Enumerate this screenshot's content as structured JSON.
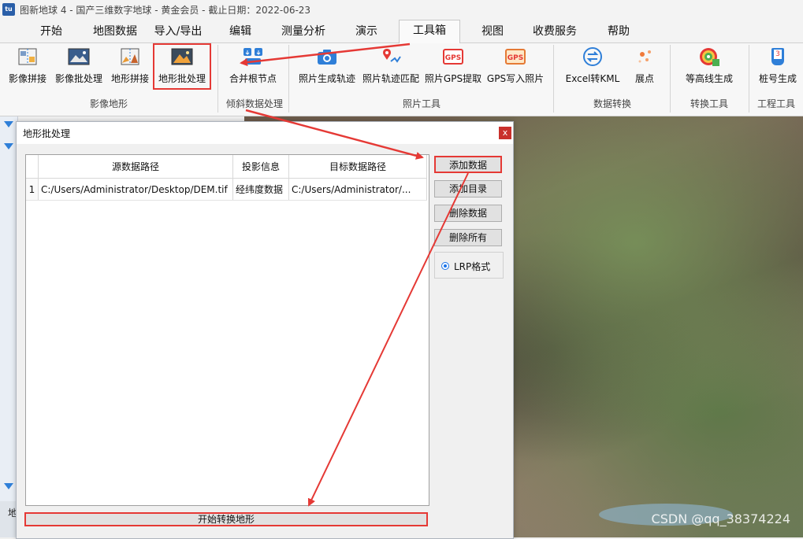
{
  "window": {
    "title": "图新地球 4 - 国产三维数字地球 - 黄金会员 - 截止日期：2022-06-23",
    "icon": "app-logo-icon"
  },
  "menu": [
    "开始",
    "地图数据",
    "导入/导出",
    "编辑",
    "测量分析",
    "演示",
    "工具箱",
    "视图",
    "收费服务",
    "帮助"
  ],
  "active_menu": "工具箱",
  "ribbon": {
    "groups": [
      {
        "label": "影像地形",
        "tools": [
          "影像拼接",
          "影像批处理",
          "地形拼接",
          "地形批处理"
        ]
      },
      {
        "label": "倾斜数据处理",
        "tools": [
          "合并根节点"
        ]
      },
      {
        "label": "照片工具",
        "tools": [
          "照片生成轨迹",
          "照片轨迹匹配",
          "照片GPS提取",
          "GPS写入照片"
        ]
      },
      {
        "label": "数据转换",
        "tools": [
          "Excel转KML",
          "展点"
        ]
      },
      {
        "label": "转换工具",
        "tools": [
          "等高线生成"
        ]
      },
      {
        "label": "工程工具",
        "tools": [
          "桩号生成"
        ]
      }
    ],
    "icon_texts": {
      "gps": "GPS",
      "stake": "3"
    }
  },
  "dialog": {
    "title": "地形批处理",
    "close": "x",
    "columns": [
      "源数据路径",
      "投影信息",
      "目标数据路径"
    ],
    "rows": [
      {
        "num": "1",
        "source": "C:/Users/Administrator/Desktop/DEM.tif",
        "projection": "经纬度数据",
        "target": "C:/Users/Administrator/..."
      }
    ],
    "buttons": {
      "add_data": "添加数据",
      "add_dir": "添加目录",
      "delete_data": "删除数据",
      "delete_all": "删除所有"
    },
    "format_option": "LRP格式",
    "start_button": "开始转换地形"
  },
  "left_panel": {
    "bottom_label": "地"
  },
  "watermark": "CSDN @qq_38374224",
  "colors": {
    "highlight": "#e53935",
    "accent": "#2f7fd8"
  }
}
